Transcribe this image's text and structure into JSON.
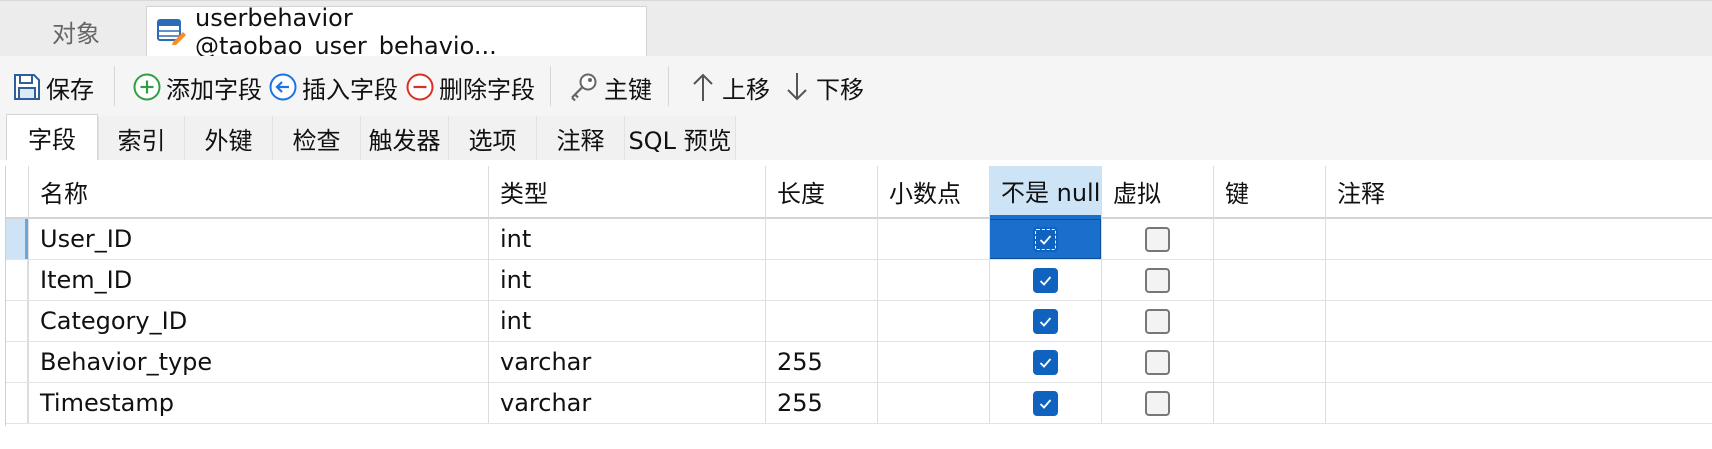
{
  "tabs": {
    "objects_label": "对象",
    "table_label": "userbehavior @taobao_user_behavio..."
  },
  "toolbar": {
    "save": "保存",
    "add_field": "添加字段",
    "insert_field": "插入字段",
    "delete_field": "删除字段",
    "primary_key": "主键",
    "move_up": "上移",
    "move_down": "下移"
  },
  "subtabs": [
    "字段",
    "索引",
    "外键",
    "检查",
    "触发器",
    "选项",
    "注释",
    "SQL 预览"
  ],
  "grid": {
    "columns": [
      "名称",
      "类型",
      "长度",
      "小数点",
      "不是 null",
      "虚拟",
      "键",
      "注释"
    ],
    "rows": [
      {
        "name": "User_ID",
        "type": "int",
        "length": "",
        "decimals": "",
        "not_null": true,
        "virtual": false,
        "key": "",
        "comment": ""
      },
      {
        "name": "Item_ID",
        "type": "int",
        "length": "",
        "decimals": "",
        "not_null": true,
        "virtual": false,
        "key": "",
        "comment": ""
      },
      {
        "name": "Category_ID",
        "type": "int",
        "length": "",
        "decimals": "",
        "not_null": true,
        "virtual": false,
        "key": "",
        "comment": ""
      },
      {
        "name": "Behavior_type",
        "type": "varchar",
        "length": "255",
        "decimals": "",
        "not_null": true,
        "virtual": false,
        "key": "",
        "comment": ""
      },
      {
        "name": "Timestamp",
        "type": "varchar",
        "length": "255",
        "decimals": "",
        "not_null": true,
        "virtual": false,
        "key": "",
        "comment": ""
      }
    ]
  },
  "colors": {
    "accent": "#1a6fcc",
    "checkbox_on": "#0f62bd",
    "header_selected": "#cde4f7",
    "add_icon": "#2f9e44",
    "insert_icon": "#1a73e8",
    "delete_icon": "#d93025"
  },
  "icons": {
    "table_tab": "table-edit-icon",
    "save": "save-disk-icon",
    "add_field": "plus-circle-icon",
    "insert_field": "arrow-left-circle-icon",
    "delete_field": "minus-circle-icon",
    "primary_key": "key-icon",
    "move_up": "arrow-up-icon",
    "move_down": "arrow-down-icon"
  }
}
